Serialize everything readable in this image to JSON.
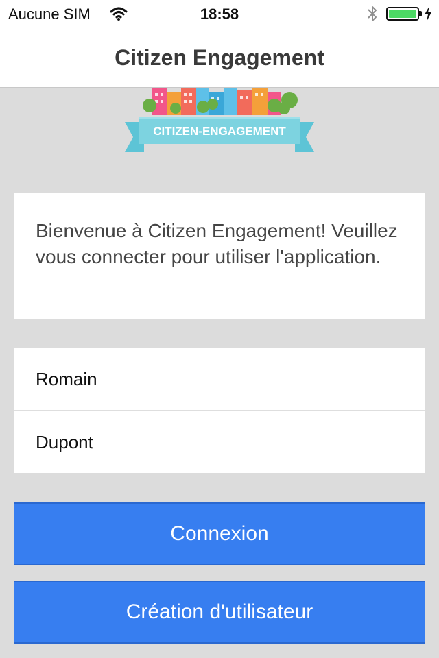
{
  "status_bar": {
    "carrier": "Aucune SIM",
    "time": "18:58",
    "battery_level": 1.0
  },
  "nav": {
    "title": "Citizen Engagement"
  },
  "logo": {
    "banner_text": "CITIZEN-ENGAGEMENT"
  },
  "welcome": {
    "message": "Bienvenue à Citizen Engagement! Veuillez vous connecter pour utiliser l'application."
  },
  "form": {
    "first_name_value": "Romain",
    "last_name_value": "Dupont"
  },
  "actions": {
    "login_label": "Connexion",
    "signup_label": "Création d'utilisateur"
  },
  "colors": {
    "primary_button": "#377ef0",
    "background": "#dcdcdc",
    "battery": "#4cd964"
  }
}
